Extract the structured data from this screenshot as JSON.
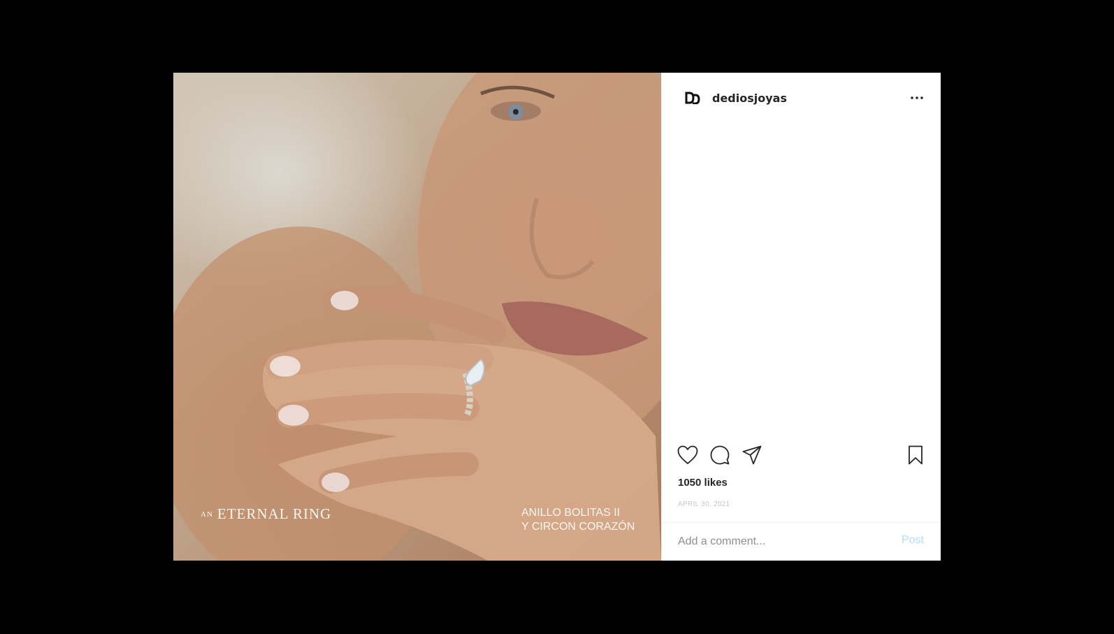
{
  "post": {
    "image_caption_left_small": "AN",
    "image_caption_left": "ETERNAL RING",
    "image_caption_right_line1": "ANILLO BOLITAS II",
    "image_caption_right_line2": "Y CIRCON CORAZÓN"
  },
  "header": {
    "username": "dediosjoyas",
    "avatar_icon": "brand-logo-icon",
    "more_icon": "more-options-icon"
  },
  "actions": {
    "like_icon": "heart-icon",
    "comment_icon": "comment-icon",
    "share_icon": "send-icon",
    "save_icon": "bookmark-icon"
  },
  "stats": {
    "likes": "1050 likes",
    "date": "APRIL 30, 2021"
  },
  "comment": {
    "placeholder": "Add a comment...",
    "post_label": "Post"
  },
  "colors": {
    "text_primary": "#262626",
    "post_button_disabled": "#b3dbff",
    "placeholder": "#8e8e8e",
    "date": "#c7c7c7"
  }
}
